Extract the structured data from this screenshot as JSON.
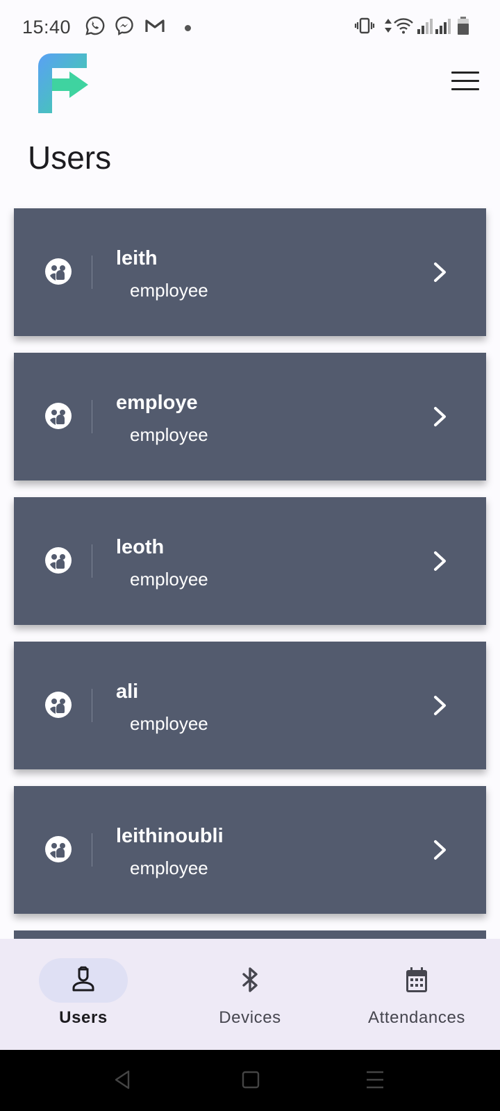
{
  "status_bar": {
    "time": "15:40",
    "left_icons": [
      "whatsapp-icon",
      "messenger-icon",
      "gmail-icon"
    ],
    "right_icons": [
      "vibrate-icon",
      "data-arrows-icon",
      "wifi-icon",
      "signal-icon",
      "signal-icon",
      "battery-icon"
    ]
  },
  "header": {
    "logo": "app-logo-f",
    "menu_icon": "hamburger-menu-icon",
    "title": "Users"
  },
  "users": [
    {
      "name": "leith",
      "role": "employee"
    },
    {
      "name": "employe",
      "role": "employee"
    },
    {
      "name": "leoth",
      "role": "employee"
    },
    {
      "name": "ali",
      "role": "employee"
    },
    {
      "name": "leithinoubli",
      "role": "employee"
    }
  ],
  "bottom_nav": {
    "items": [
      {
        "label": "Users",
        "icon": "user-badge-icon",
        "active": true
      },
      {
        "label": "Devices",
        "icon": "bluetooth-icon",
        "active": false
      },
      {
        "label": "Attendances",
        "icon": "calendar-icon",
        "active": false
      }
    ]
  },
  "colors": {
    "card_background": "#535b6e",
    "page_background": "#fcfbfe",
    "nav_background": "#eeeaf6",
    "nav_active_pill": "#dfe0f4",
    "logo_gradient_start": "#5aa0f5",
    "logo_gradient_end": "#3fd3a0"
  }
}
